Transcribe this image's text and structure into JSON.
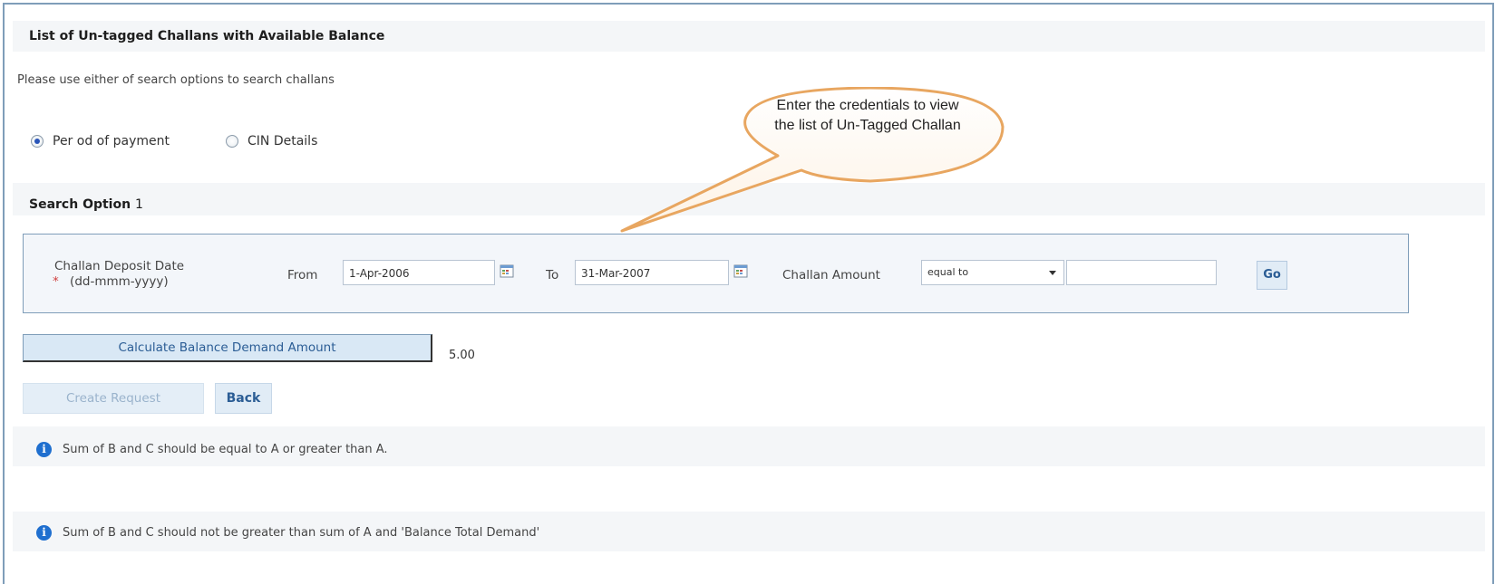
{
  "page": {
    "title": "List of Un-tagged Challans with Available Balance",
    "instructions": "Please use either of search options to search challans"
  },
  "search_type": {
    "options": [
      {
        "label": "Per od of payment",
        "selected": true
      },
      {
        "label": "CIN Details",
        "selected": false
      }
    ]
  },
  "search_option": {
    "title": "Search Option",
    "number": "1",
    "deposit_date_label": "Challan Deposit Date",
    "date_format": "(dd-mmm-yyyy)",
    "required_marker": "*",
    "from_label": "From",
    "from_value": "1-Apr-2006",
    "to_label": "To",
    "to_value": "31-Mar-2007",
    "amount_label": "Challan Amount",
    "amount_operator": "equal to",
    "amount_value": "",
    "go_label": "Go"
  },
  "balance": {
    "calc_button_label": "Calculate Balance Demand Amount",
    "value": "5.00"
  },
  "actions": {
    "create_label": "Create Request",
    "back_label": "Back"
  },
  "info": {
    "icon": "info-icon",
    "messages": [
      "Sum of B and C should be equal to A or greater than A.",
      "Sum of B and C should not be greater than sum of A and 'Balance Total Demand'"
    ]
  },
  "callout": {
    "text": "Enter the credentials to view the list of Un-Tagged Challan"
  },
  "colors": {
    "frame_border": "#7f9db9",
    "band_bg": "#f4f6f8",
    "button_text": "#2b5d95",
    "callout_stroke": "#e8a660",
    "info_icon": "#1f6fcf"
  }
}
